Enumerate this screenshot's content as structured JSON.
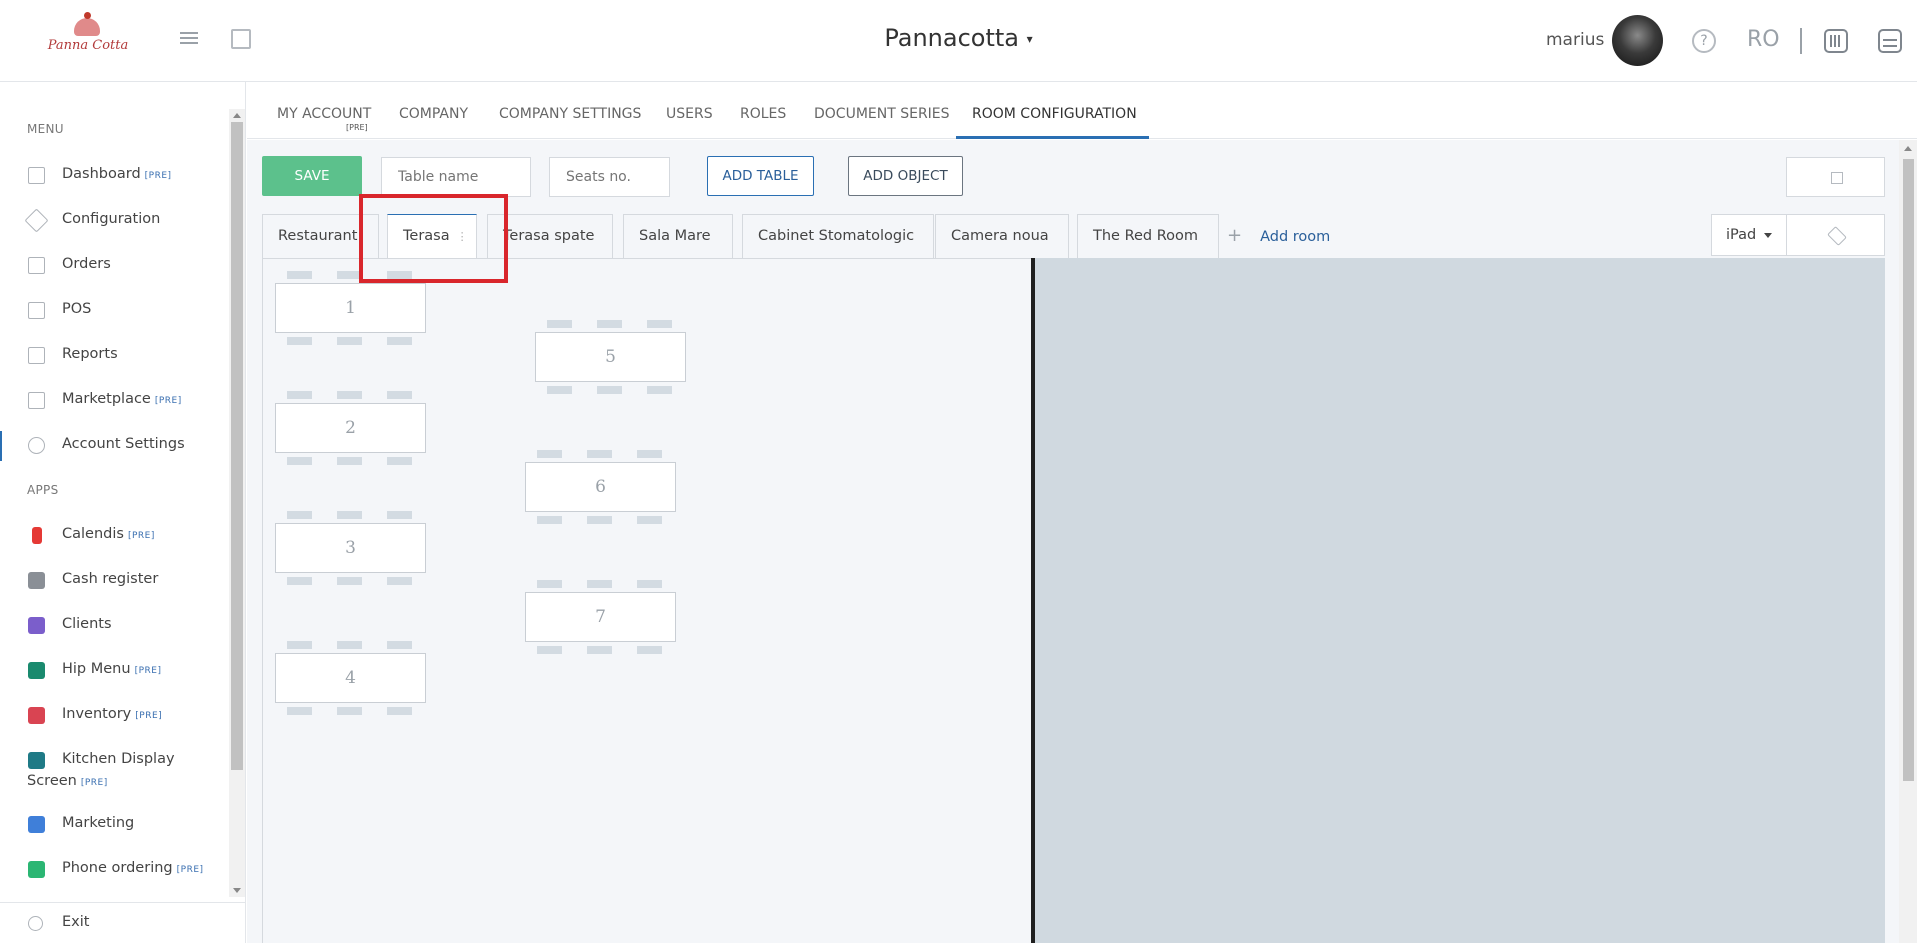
{
  "header": {
    "logo_text": "Panna Cotta",
    "title": "Pannacotta",
    "user_name": "marius",
    "language": "RO"
  },
  "sidebar": {
    "menu_heading": "MENU",
    "apps_heading": "APPS",
    "menu_items": [
      {
        "label": "Dashboard",
        "badge": "[PRE]",
        "icon": "dashboard-icon"
      },
      {
        "label": "Configuration",
        "badge": "",
        "icon": "tag-icon"
      },
      {
        "label": "Orders",
        "badge": "",
        "icon": "orders-icon"
      },
      {
        "label": "POS",
        "badge": "",
        "icon": "pos-icon"
      },
      {
        "label": "Reports",
        "badge": "",
        "icon": "reports-icon"
      },
      {
        "label": "Marketplace",
        "badge": "[PRE]",
        "icon": "cart-icon"
      },
      {
        "label": "Account Settings",
        "badge": "",
        "icon": "gear-icon"
      }
    ],
    "app_items": [
      {
        "label": "Calendis",
        "badge": "[PRE]",
        "color": "#e53935"
      },
      {
        "label": "Cash register",
        "badge": "",
        "color": "#8a8f96"
      },
      {
        "label": "Clients",
        "badge": "",
        "color": "#7b5ecb"
      },
      {
        "label": "Hip Menu",
        "badge": "[PRE]",
        "color": "#1a8a6e"
      },
      {
        "label": "Inventory",
        "badge": "[PRE]",
        "color": "#d94452"
      },
      {
        "label": "Kitchen Display",
        "label2": "Screen",
        "badge": "[PRE]",
        "color": "#1f7a86"
      },
      {
        "label": "Marketing",
        "badge": "",
        "color": "#3f7fd9"
      },
      {
        "label": "Phone ordering",
        "badge": "[PRE]",
        "color": "#2bb673"
      }
    ],
    "exit_label": "Exit"
  },
  "tabs": {
    "items": [
      "MY ACCOUNT",
      "COMPANY",
      "COMPANY SETTINGS",
      "USERS",
      "ROLES",
      "DOCUMENT SERIES",
      "ROOM CONFIGURATION"
    ],
    "my_account_badge": "[PRE]",
    "active": "ROOM CONFIGURATION"
  },
  "toolbar": {
    "save_label": "SAVE",
    "table_name_placeholder": "Table name",
    "seats_placeholder": "Seats no.",
    "add_table_label": "ADD TABLE",
    "add_object_label": "ADD OBJECT"
  },
  "rooms": {
    "items": [
      "Restaurant",
      "Terasa",
      "Terasa spate",
      "Sala Mare",
      "Cabinet Stomatologic",
      "Camera noua",
      "The Red Room"
    ],
    "active": "Terasa",
    "add_room_label": "Add room",
    "device_label": "iPad"
  },
  "floor_tables": [
    {
      "number": "1",
      "seats": 6
    },
    {
      "number": "2",
      "seats": 6
    },
    {
      "number": "3",
      "seats": 6
    },
    {
      "number": "4",
      "seats": 6
    },
    {
      "number": "5",
      "seats": 6
    },
    {
      "number": "6",
      "seats": 6
    },
    {
      "number": "7",
      "seats": 6
    }
  ],
  "colors": {
    "accent": "#2a6fb3",
    "save": "#5cc18c",
    "highlight": "#d9262c"
  }
}
